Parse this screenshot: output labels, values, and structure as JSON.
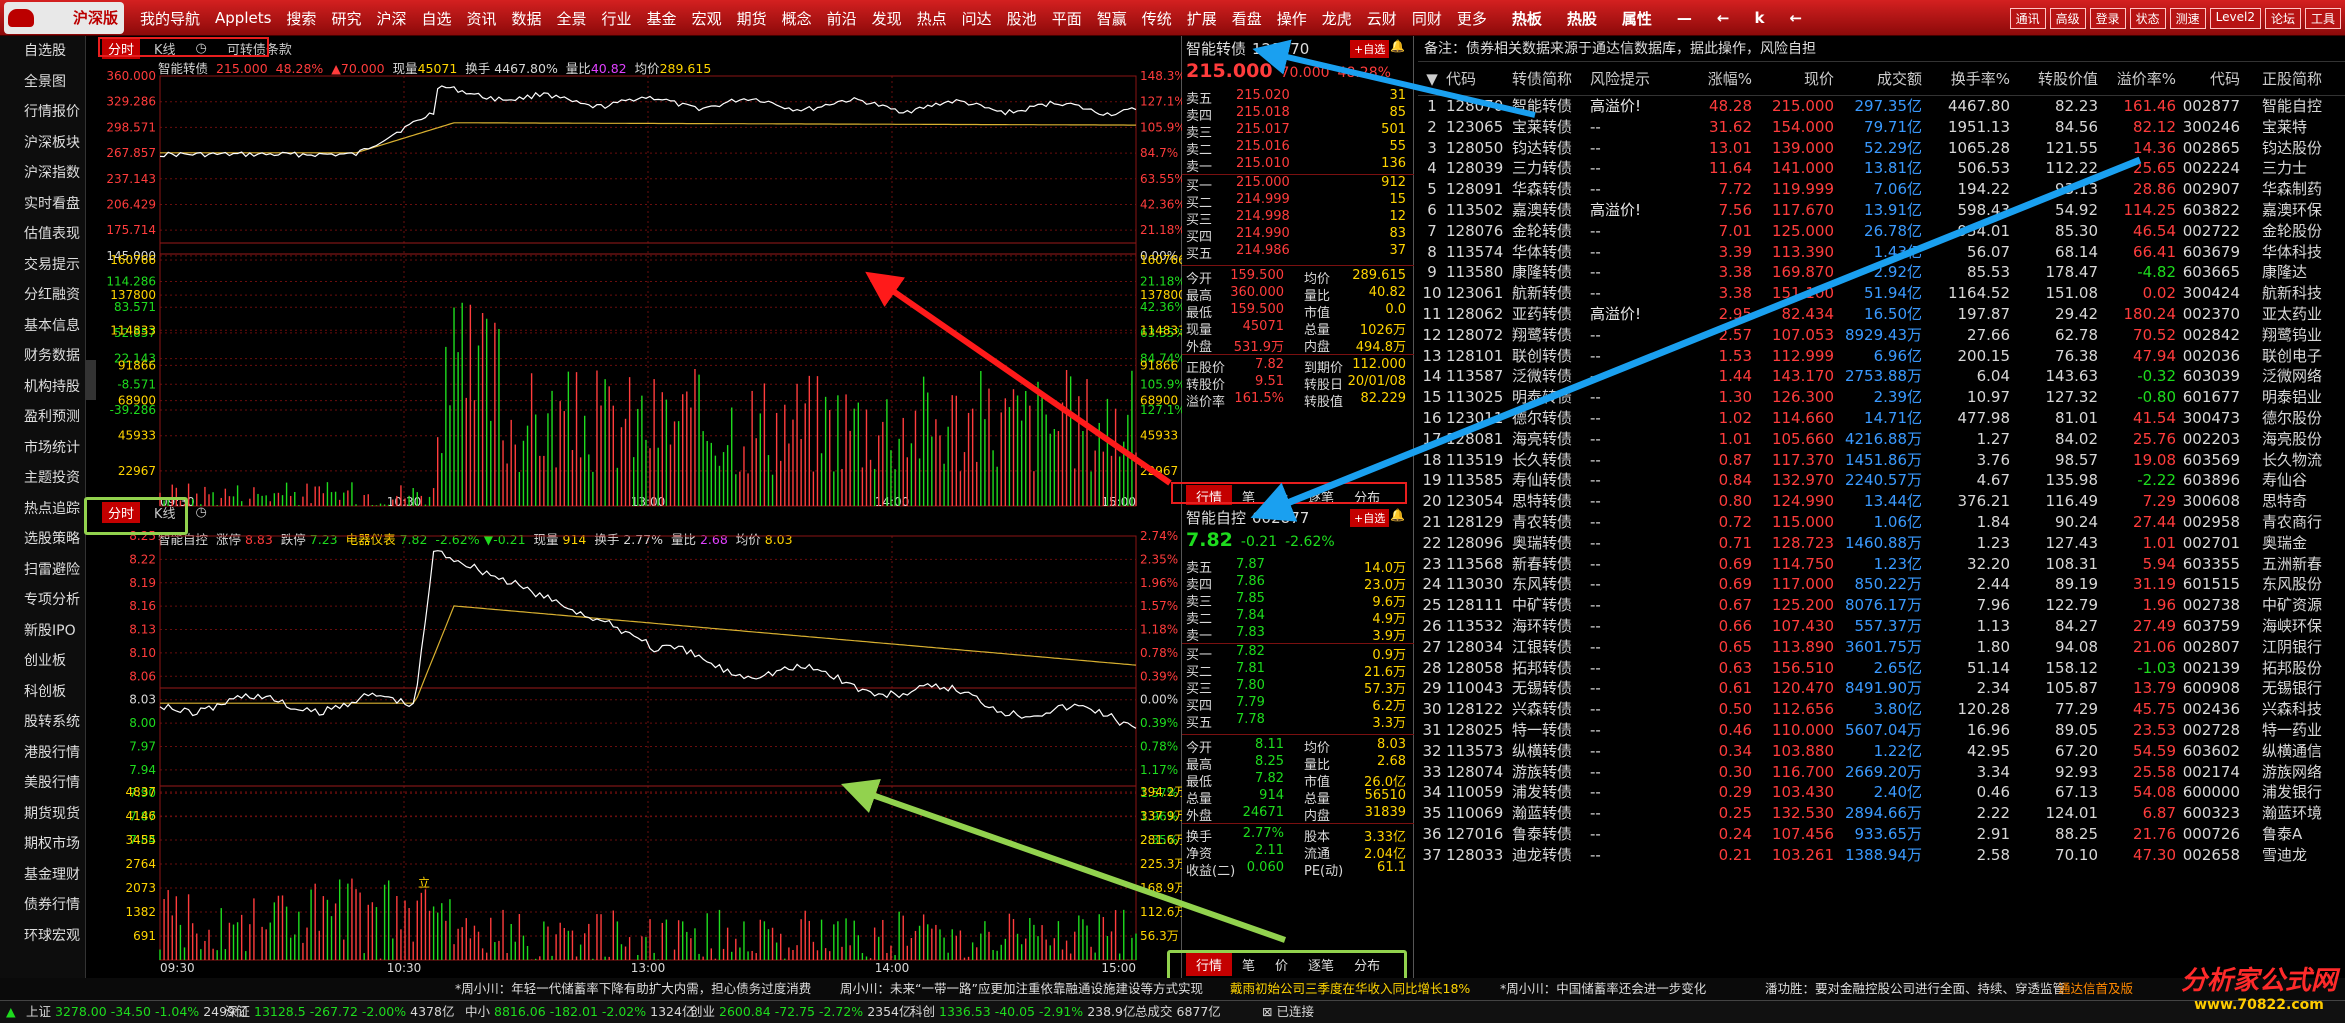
{
  "app": {
    "logo": "沪深版"
  },
  "menu": [
    "我的导航",
    "Applets",
    "搜索",
    "研究",
    "沪深",
    "自选",
    "资讯",
    "数据",
    "全景",
    "行业",
    "基金",
    "宏观",
    "期货",
    "概念",
    "前沿",
    "发现",
    "热点",
    "问达",
    "股池",
    "平面",
    "智赢",
    "传统",
    "扩展",
    "看盘",
    "操作",
    "龙虎",
    "云财",
    "同财",
    "更多",
    "热板",
    "热股",
    "属性",
    "—",
    "←",
    "k",
    "←"
  ],
  "right_btns": [
    "通讯",
    "高级",
    "登录",
    "状态",
    "测速",
    "Level2",
    "论坛",
    "工具"
  ],
  "sidebar": [
    "自选股",
    "全景图",
    "行情报价",
    "沪深板块",
    "沪深指数",
    "实时看盘",
    "估值表现",
    "交易提示",
    "分红融资",
    "基本信息",
    "财务数据",
    "机构持股",
    "盈利预测",
    "市场统计",
    "主题投资",
    "热点追踪",
    "选股策略",
    "扫雷避险",
    "专项分析",
    "新股IPO",
    "创业板",
    "科创板",
    "股转系统",
    "港股行情",
    "美股行情",
    "期货现货",
    "期权市场",
    "基金理财",
    "债券行情",
    "环球宏观"
  ],
  "top_chart": {
    "tabs": [
      "分时",
      "K线",
      "可转债条款"
    ],
    "info_name": "智能转债",
    "info_price": "215.000",
    "info_pct": "48.28%",
    "info_chg": "▲70.000",
    "info_vol_label": "现量",
    "info_vol": "45071",
    "info_turn": "换手 4467.80%",
    "info_lb_label": "量比",
    "info_lb": "40.82",
    "info_avg_label": "均价",
    "info_avg": "289.615",
    "left_ticks": [
      "360.000",
      "329.286",
      "298.571",
      "267.857",
      "237.143",
      "206.429",
      "175.714",
      "145.000",
      "114.286",
      "83.571",
      "52.857",
      "22.143",
      "-8.571",
      "-39.286"
    ],
    "right_ticks": [
      "148.3%",
      "127.1%",
      "105.9%",
      "84.7%",
      "63.55%",
      "42.36%",
      "21.18%",
      "0.00%",
      "21.18%",
      "42.36%",
      "63.55%",
      "84.74%",
      "105.9%",
      "127.1%"
    ],
    "vol_left": [
      "160766",
      "137800",
      "114833",
      "91866",
      "68900",
      "45933",
      "22967"
    ],
    "vol_right": [
      "160766",
      "137800",
      "114833",
      "91866",
      "68900",
      "45933",
      "22967"
    ],
    "time_labels": [
      "09:30",
      "10:30",
      "13:00",
      "14:00",
      "15:00"
    ]
  },
  "bot_chart": {
    "tabs": [
      "分时",
      "K线"
    ],
    "info_name": "智能自控",
    "info_zt_label": "涨停",
    "info_zt": "8.83",
    "info_dt_label": "跌停",
    "info_dt": "7.23",
    "info_sector": "电器仪表",
    "info_sector_px": "7.82",
    "info_sector_pct": "-2.62%",
    "info_sector_chg": "▼-0.21",
    "info_vol_label": "现量",
    "info_vol": "914",
    "info_turn": "换手 2.77%",
    "info_lb_label": "量比",
    "info_lb": "2.68",
    "info_avg_label": "均价",
    "info_avg": "8.03",
    "left_ticks": [
      "8.25",
      "8.22",
      "8.19",
      "8.16",
      "8.13",
      "8.10",
      "8.06",
      "8.03",
      "8.00",
      "7.97",
      "7.94",
      "7.90",
      "7.87",
      "7.84"
    ],
    "right_ticks": [
      "2.74%",
      "2.35%",
      "1.96%",
      "1.57%",
      "1.18%",
      "0.78%",
      "0.39%",
      "0.00%",
      "0.39%",
      "0.78%",
      "1.17%",
      "1.57%",
      "1.96%",
      "2.35%"
    ],
    "vol_left": [
      "4837",
      "4146",
      "3455",
      "2764",
      "2073",
      "1382",
      "691"
    ],
    "vol_right": [
      "394.2万",
      "337.9万",
      "281.6万",
      "225.3万",
      "168.9万",
      "112.6万",
      "56.3万"
    ],
    "time_labels": [
      "09:30",
      "10:30",
      "13:00",
      "14:00",
      "15:00"
    ],
    "marker": "立"
  },
  "quote_top": {
    "name": "智能转债",
    "code": "128070",
    "px": "215.000",
    "chg": "70.000",
    "pct": "48.28%",
    "add_btn": "+自选",
    "asks": [
      [
        "卖五",
        "215.020",
        "31"
      ],
      [
        "卖四",
        "215.018",
        "85"
      ],
      [
        "卖三",
        "215.017",
        "501"
      ],
      [
        "卖二",
        "215.016",
        "55"
      ],
      [
        "卖一",
        "215.010",
        "136"
      ]
    ],
    "bids": [
      [
        "买一",
        "215.000",
        "912"
      ],
      [
        "买二",
        "214.999",
        "15"
      ],
      [
        "买三",
        "214.998",
        "12"
      ],
      [
        "买四",
        "214.990",
        "83"
      ],
      [
        "买五",
        "214.986",
        "37"
      ]
    ],
    "stats": [
      [
        "今开",
        "159.500",
        "均价",
        "289.615"
      ],
      [
        "最高",
        "360.000",
        "量比",
        "40.82"
      ],
      [
        "最低",
        "159.500",
        "市值",
        "0.0"
      ],
      [
        "现量",
        "45071",
        "总量",
        "1026万"
      ],
      [
        "外盘",
        "531.9万",
        "内盘",
        "494.8万"
      ]
    ],
    "extra": [
      [
        "正股价",
        "7.82",
        "到期价",
        "112.000"
      ],
      [
        "转股价",
        "9.51",
        "转股日",
        "20/01/08"
      ],
      [
        "溢价率",
        "161.5%",
        "转股值",
        "82.229"
      ]
    ],
    "tabs": [
      "行情",
      "笔",
      "价",
      "逐笔",
      "分布"
    ]
  },
  "quote_bot": {
    "name": "智能自控",
    "code": "002877",
    "px": "7.82",
    "chg": "-0.21",
    "pct": "-2.62%",
    "add_btn": "+自选",
    "asks": [
      [
        "卖五",
        "7.87",
        "14.0万"
      ],
      [
        "卖四",
        "7.86",
        "23.0万"
      ],
      [
        "卖三",
        "7.85",
        "9.6万"
      ],
      [
        "卖二",
        "7.84",
        "4.9万"
      ],
      [
        "卖一",
        "7.83",
        "3.9万"
      ]
    ],
    "bids": [
      [
        "买一",
        "7.82",
        "0.9万"
      ],
      [
        "买二",
        "7.81",
        "21.6万"
      ],
      [
        "买三",
        "7.80",
        "57.3万"
      ],
      [
        "买四",
        "7.79",
        "6.2万"
      ],
      [
        "买五",
        "7.78",
        "3.3万"
      ]
    ],
    "stats": [
      [
        "今开",
        "8.11",
        "均价",
        "8.03"
      ],
      [
        "最高",
        "8.25",
        "量比",
        "2.68"
      ],
      [
        "最低",
        "7.82",
        "市值",
        "26.0亿"
      ],
      [
        "总量",
        "914",
        "总量",
        "56510"
      ],
      [
        "外盘",
        "24671",
        "内盘",
        "31839"
      ]
    ],
    "extra": [
      [
        "换手",
        "2.77%",
        "股本",
        "3.33亿"
      ],
      [
        "净资",
        "2.11",
        "流通",
        "2.04亿"
      ],
      [
        "收益(二)",
        "0.060",
        "PE(动)",
        "61.1"
      ]
    ],
    "tabs": [
      "行情",
      "笔",
      "价",
      "逐笔",
      "分布"
    ]
  },
  "table": {
    "note": "备注：债券相关数据来源于通达信数据库，据此操作，风险自担",
    "headers": [
      "",
      "代码",
      "转债简称",
      "风险提示",
      "涨幅%",
      "现价",
      "成交额",
      "换手率%",
      "转股价值",
      "溢价率%",
      "代码",
      "正股简称"
    ],
    "rows": [
      [
        "1",
        "128070",
        "智能转债",
        "高溢价!",
        "48.28",
        "215.000",
        "297.35亿",
        "4467.80",
        "82.23",
        "161.46",
        "002877",
        "智能自控"
      ],
      [
        "2",
        "123065",
        "宝莱转债",
        "--",
        "31.62",
        "154.000",
        "79.71亿",
        "1951.13",
        "84.56",
        "82.12",
        "300246",
        "宝莱特"
      ],
      [
        "3",
        "128050",
        "钧达转债",
        "--",
        "13.01",
        "139.000",
        "52.29亿",
        "1065.28",
        "121.55",
        "14.36",
        "002865",
        "钧达股份"
      ],
      [
        "4",
        "128039",
        "三力转债",
        "--",
        "11.64",
        "141.000",
        "13.81亿",
        "506.53",
        "112.22",
        "25.65",
        "002224",
        "三力士"
      ],
      [
        "5",
        "128091",
        "华森转债",
        "--",
        "7.72",
        "119.999",
        "7.06亿",
        "194.22",
        "93.13",
        "28.86",
        "002907",
        "华森制药"
      ],
      [
        "6",
        "113502",
        "嘉澳转债",
        "高溢价!",
        "7.56",
        "117.670",
        "13.91亿",
        "598.43",
        "54.92",
        "114.25",
        "603822",
        "嘉澳环保"
      ],
      [
        "7",
        "128076",
        "金轮转债",
        "--",
        "7.01",
        "125.000",
        "26.78亿",
        "954.01",
        "85.30",
        "46.54",
        "002722",
        "金轮股份"
      ],
      [
        "8",
        "113574",
        "华体转债",
        "--",
        "3.39",
        "113.390",
        "1.43亿",
        "56.07",
        "68.14",
        "66.41",
        "603679",
        "华体科技"
      ],
      [
        "9",
        "113580",
        "康隆转债",
        "--",
        "3.38",
        "169.870",
        "2.92亿",
        "85.53",
        "178.47",
        "-4.82",
        "603665",
        "康隆达"
      ],
      [
        "10",
        "123061",
        "航新转债",
        "--",
        "3.38",
        "151.100",
        "51.94亿",
        "1164.52",
        "151.08",
        "0.02",
        "300424",
        "航新科技"
      ],
      [
        "11",
        "128062",
        "亚药转债",
        "高溢价!",
        "2.95",
        "82.434",
        "16.50亿",
        "197.87",
        "29.42",
        "180.24",
        "002370",
        "亚太药业"
      ],
      [
        "12",
        "128072",
        "翔鹭转债",
        "--",
        "2.57",
        "107.053",
        "8929.43万",
        "27.66",
        "62.78",
        "70.52",
        "002842",
        "翔鹭钨业"
      ],
      [
        "13",
        "128101",
        "联创转债",
        "--",
        "1.53",
        "112.999",
        "6.96亿",
        "200.15",
        "76.38",
        "47.94",
        "002036",
        "联创电子"
      ],
      [
        "14",
        "113587",
        "泛微转债",
        "--",
        "1.44",
        "143.170",
        "2753.88万",
        "6.04",
        "143.63",
        "-0.32",
        "603039",
        "泛微网络"
      ],
      [
        "15",
        "113025",
        "明泰转债",
        "--",
        "1.30",
        "126.300",
        "2.39亿",
        "10.97",
        "127.32",
        "-0.80",
        "601677",
        "明泰铝业"
      ],
      [
        "16",
        "123011",
        "德尔转债",
        "--",
        "1.02",
        "114.660",
        "14.71亿",
        "477.98",
        "81.01",
        "41.54",
        "300473",
        "德尔股份"
      ],
      [
        "17",
        "128081",
        "海亮转债",
        "--",
        "1.01",
        "105.660",
        "4216.88万",
        "1.27",
        "84.02",
        "25.76",
        "002203",
        "海亮股份"
      ],
      [
        "18",
        "113519",
        "长久转债",
        "--",
        "0.87",
        "117.370",
        "1451.86万",
        "3.76",
        "98.57",
        "19.08",
        "603569",
        "长久物流"
      ],
      [
        "19",
        "113585",
        "寿仙转债",
        "--",
        "0.84",
        "132.970",
        "2240.57万",
        "4.67",
        "135.98",
        "-2.22",
        "603896",
        "寿仙谷"
      ],
      [
        "20",
        "123054",
        "思特转债",
        "--",
        "0.80",
        "124.990",
        "13.44亿",
        "376.21",
        "116.49",
        "7.29",
        "300608",
        "思特奇"
      ],
      [
        "21",
        "128129",
        "青农转债",
        "--",
        "0.72",
        "115.000",
        "1.06亿",
        "1.84",
        "90.24",
        "27.44",
        "002958",
        "青农商行"
      ],
      [
        "22",
        "128096",
        "奥瑞转债",
        "--",
        "0.71",
        "128.723",
        "1460.88万",
        "1.23",
        "127.43",
        "1.01",
        "002701",
        "奥瑞金"
      ],
      [
        "23",
        "113568",
        "新春转债",
        "--",
        "0.69",
        "114.750",
        "1.23亿",
        "32.20",
        "108.31",
        "5.94",
        "603355",
        "五洲新春"
      ],
      [
        "24",
        "113030",
        "东风转债",
        "--",
        "0.69",
        "117.000",
        "850.22万",
        "2.44",
        "89.19",
        "31.19",
        "601515",
        "东风股份"
      ],
      [
        "25",
        "128111",
        "中矿转债",
        "--",
        "0.67",
        "125.200",
        "8076.17万",
        "7.96",
        "122.79",
        "1.96",
        "002738",
        "中矿资源"
      ],
      [
        "26",
        "113532",
        "海环转债",
        "--",
        "0.66",
        "107.430",
        "557.37万",
        "1.13",
        "84.27",
        "27.49",
        "603759",
        "海峡环保"
      ],
      [
        "27",
        "128034",
        "江银转债",
        "--",
        "0.65",
        "113.890",
        "3601.75万",
        "1.80",
        "94.08",
        "21.06",
        "002807",
        "江阴银行"
      ],
      [
        "28",
        "128058",
        "拓邦转债",
        "--",
        "0.63",
        "156.510",
        "2.65亿",
        "51.14",
        "158.12",
        "-1.03",
        "002139",
        "拓邦股份"
      ],
      [
        "29",
        "110043",
        "无锡转债",
        "--",
        "0.61",
        "120.470",
        "8491.90万",
        "2.34",
        "105.87",
        "13.79",
        "600908",
        "无锡银行"
      ],
      [
        "30",
        "128122",
        "兴森转债",
        "--",
        "0.50",
        "112.656",
        "3.80亿",
        "120.28",
        "77.29",
        "45.75",
        "002436",
        "兴森科技"
      ],
      [
        "31",
        "128025",
        "特一转债",
        "--",
        "0.46",
        "110.000",
        "5607.04万",
        "16.96",
        "89.05",
        "23.53",
        "002728",
        "特一药业"
      ],
      [
        "32",
        "113573",
        "纵横转债",
        "--",
        "0.34",
        "103.880",
        "1.22亿",
        "42.95",
        "67.20",
        "54.59",
        "603602",
        "纵横通信"
      ],
      [
        "33",
        "128074",
        "游族转债",
        "--",
        "0.30",
        "116.700",
        "2669.20万",
        "3.34",
        "92.93",
        "25.58",
        "002174",
        "游族网络"
      ],
      [
        "34",
        "110059",
        "浦发转债",
        "--",
        "0.29",
        "103.430",
        "2.40亿",
        "0.46",
        "67.13",
        "54.08",
        "600000",
        "浦发银行"
      ],
      [
        "35",
        "110069",
        "瀚蓝转债",
        "--",
        "0.25",
        "132.530",
        "2894.66万",
        "2.22",
        "124.01",
        "6.87",
        "600323",
        "瀚蓝环境"
      ],
      [
        "36",
        "127016",
        "鲁泰转债",
        "--",
        "0.24",
        "107.456",
        "933.65万",
        "2.91",
        "88.25",
        "21.76",
        "000726",
        "鲁泰A"
      ],
      [
        "37",
        "128033",
        "迪龙转债",
        "--",
        "0.21",
        "103.261",
        "1388.94万",
        "2.58",
        "70.10",
        "47.30",
        "002658",
        "雪迪龙"
      ]
    ]
  },
  "ticker": {
    "l1": "*周小川：年轻一代储蓄率下降有助扩大内需，担心债务过度消费",
    "l2": "周小川：未来“一带一路”应更加注重依靠融通设施建设等方式实现",
    "l3": "戴雨初始公司三季度在华收入同比增长18%",
    "l4": "*周小川：中国储蓄率还会进一步变化",
    "l5": "潘功胜：要对金融控股公司进行全面、持续、穿透监管",
    "l6": "通达信首及版"
  },
  "status": {
    "sh_label": "上证",
    "sh": "3278.00",
    "sh_chg": "-34.50",
    "sh_pct": "-1.04%",
    "sh_amt": "2499亿",
    "sz_label": "深证",
    "sz": "13128.5",
    "sz_chg": "-267.72",
    "sz_pct": "-2.00%",
    "sz_amt": "4378亿",
    "zx_label": "中小",
    "zx": "8816.06",
    "zx_chg": "-182.01",
    "zx_pct": "-2.02%",
    "zx_amt": "1324亿",
    "cy_label": "创业",
    "cy": "2600.84",
    "cy_chg": "-72.75",
    "cy_pct": "-2.72%",
    "cy_amt": "2354亿",
    "kc_label": "科创",
    "kc": "1336.53",
    "kc_chg": "-40.05",
    "kc_pct": "-2.91%",
    "kc_amt": "238.9亿",
    "total_label": "总成交",
    "total": "6877亿",
    "conn": "已连接"
  },
  "watermark": {
    "t1": "分析家公式网",
    "t2": "www.70822.com"
  },
  "colors": {
    "red": "#ff3c3c",
    "green": "#1edc1e",
    "yellow": "#ffd400",
    "cyan": "#00d8d8",
    "accent": "#c40000",
    "arrow_red": "#ff1a1a",
    "arrow_blue": "#1aa0f0",
    "arrow_green": "#92d24e"
  }
}
